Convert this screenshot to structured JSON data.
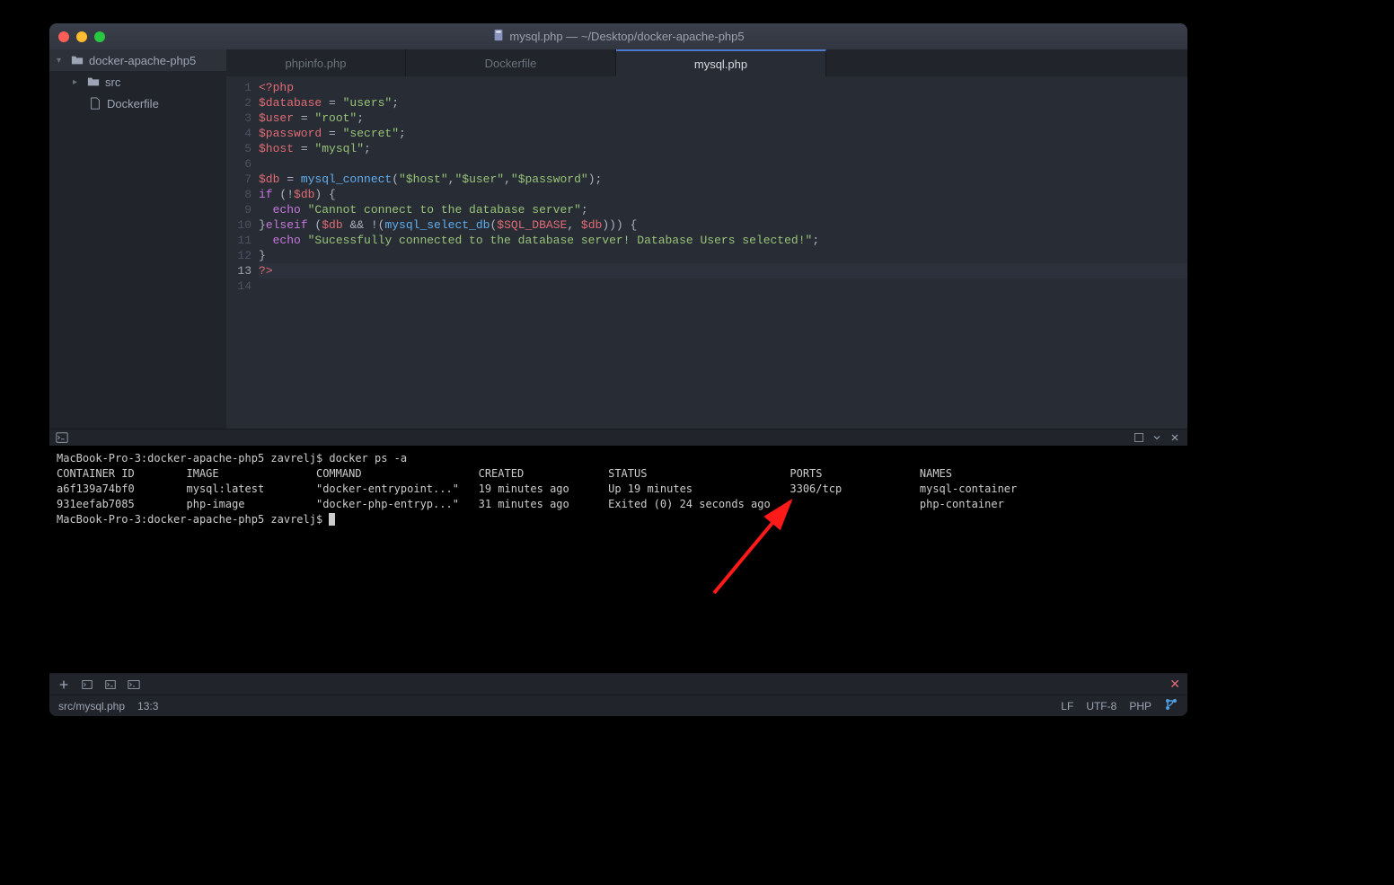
{
  "title": "mysql.php — ~/Desktop/docker-apache-php5",
  "sidebar": {
    "root": "docker-apache-php5",
    "items": [
      {
        "name": "src",
        "type": "folder"
      },
      {
        "name": "Dockerfile",
        "type": "file"
      }
    ]
  },
  "tabs": [
    {
      "label": "phpinfo.php",
      "active": false
    },
    {
      "label": "Dockerfile",
      "active": false
    },
    {
      "label": "mysql.php",
      "active": true
    }
  ],
  "code": {
    "lines": [
      {
        "n": 1,
        "tokens": [
          [
            "<?php",
            "php-tag"
          ]
        ]
      },
      {
        "n": 2,
        "tokens": [
          [
            "$database",
            "php-var"
          ],
          [
            " = ",
            "php-op"
          ],
          [
            "\"users\"",
            "php-str"
          ],
          [
            ";",
            "php-punc"
          ]
        ]
      },
      {
        "n": 3,
        "tokens": [
          [
            "$user",
            "php-var"
          ],
          [
            " = ",
            "php-op"
          ],
          [
            "\"root\"",
            "php-str"
          ],
          [
            ";",
            "php-punc"
          ]
        ]
      },
      {
        "n": 4,
        "tokens": [
          [
            "$password",
            "php-var"
          ],
          [
            " = ",
            "php-op"
          ],
          [
            "\"secret\"",
            "php-str"
          ],
          [
            ";",
            "php-punc"
          ]
        ]
      },
      {
        "n": 5,
        "tokens": [
          [
            "$host",
            "php-var"
          ],
          [
            " = ",
            "php-op"
          ],
          [
            "\"mysql\"",
            "php-str"
          ],
          [
            ";",
            "php-punc"
          ]
        ]
      },
      {
        "n": 6,
        "tokens": []
      },
      {
        "n": 7,
        "tokens": [
          [
            "$db",
            "php-var"
          ],
          [
            " = ",
            "php-op"
          ],
          [
            "mysql_connect",
            "php-fn"
          ],
          [
            "(",
            "php-punc"
          ],
          [
            "\"$host\"",
            "php-str"
          ],
          [
            ",",
            "php-punc"
          ],
          [
            "\"$user\"",
            "php-str"
          ],
          [
            ",",
            "php-punc"
          ],
          [
            "\"$password\"",
            "php-str"
          ],
          [
            ");",
            "php-punc"
          ]
        ]
      },
      {
        "n": 8,
        "tokens": [
          [
            "if",
            "php-kw"
          ],
          [
            " (!",
            "php-op"
          ],
          [
            "$db",
            "php-var"
          ],
          [
            ") {",
            "php-punc"
          ]
        ]
      },
      {
        "n": 9,
        "tokens": [
          [
            "  echo",
            "php-kw"
          ],
          [
            " ",
            "php-op"
          ],
          [
            "\"Cannot connect to the database server\"",
            "php-str"
          ],
          [
            ";",
            "php-punc"
          ]
        ]
      },
      {
        "n": 10,
        "tokens": [
          [
            "}",
            "php-punc"
          ],
          [
            "elseif",
            "php-kw"
          ],
          [
            " (",
            "php-punc"
          ],
          [
            "$db",
            "php-var"
          ],
          [
            " && !(",
            "php-op"
          ],
          [
            "mysql_select_db",
            "php-fn"
          ],
          [
            "(",
            "php-punc"
          ],
          [
            "$SQL_DBASE",
            "php-var"
          ],
          [
            ", ",
            "php-punc"
          ],
          [
            "$db",
            "php-var"
          ],
          [
            "))) {",
            "php-punc"
          ]
        ]
      },
      {
        "n": 11,
        "tokens": [
          [
            "  echo",
            "php-kw"
          ],
          [
            " ",
            "php-op"
          ],
          [
            "\"Sucessfully connected to the database server! Database Users selected!\"",
            "php-str"
          ],
          [
            ";",
            "php-punc"
          ]
        ]
      },
      {
        "n": 12,
        "tokens": [
          [
            "}",
            "php-punc"
          ]
        ]
      },
      {
        "n": 13,
        "tokens": [
          [
            "?>",
            "php-tag"
          ]
        ],
        "active": true
      },
      {
        "n": 14,
        "tokens": []
      }
    ]
  },
  "terminal": {
    "prompt": "MacBook-Pro-3:docker-apache-php5 zavrelj$ ",
    "command": "docker ps -a",
    "headers": [
      "CONTAINER ID",
      "IMAGE",
      "COMMAND",
      "CREATED",
      "STATUS",
      "PORTS",
      "NAMES"
    ],
    "rows": [
      [
        "a6f139a74bf0",
        "mysql:latest",
        "\"docker-entrypoint...\"",
        "19 minutes ago",
        "Up 19 minutes",
        "3306/tcp",
        "mysql-container"
      ],
      [
        "931eefab7085",
        "php-image",
        "\"docker-php-entryp...\"",
        "31 minutes ago",
        "Exited (0) 24 seconds ago",
        "",
        "php-container"
      ]
    ],
    "prompt2": "MacBook-Pro-3:docker-apache-php5 zavrelj$ "
  },
  "statusbar": {
    "path": "src/mysql.php",
    "pos": "13:3",
    "eol": "LF",
    "enc": "UTF-8",
    "lang": "PHP"
  }
}
